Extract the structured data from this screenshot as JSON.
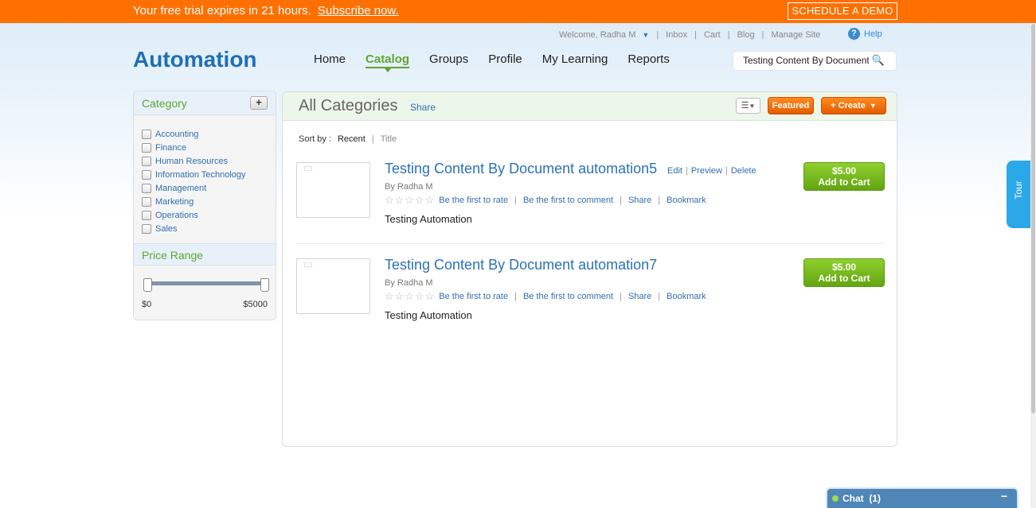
{
  "banner": {
    "trial_text": "Your free trial expires in 21 hours.",
    "subscribe_link": "Subscribe now.",
    "demo_button": "SCHEDULE A DEMO",
    "color": "#ff7000"
  },
  "utility_nav": {
    "welcome": "Welcome, Radha M",
    "inbox": "Inbox",
    "cart": "Cart",
    "blog": "Blog",
    "manage_site": "Manage Site",
    "help": "Help"
  },
  "logo": "Automation",
  "main_nav": {
    "home": "Home",
    "catalog": "Catalog",
    "groups": "Groups",
    "profile": "Profile",
    "my_learning": "My Learning",
    "reports": "Reports",
    "active": "Catalog"
  },
  "search": {
    "value": "Testing Content By Document",
    "icon": "search-icon"
  },
  "sidebar": {
    "category_title": "Category",
    "add_label": "+",
    "categories": [
      "Accounting",
      "Finance",
      "Human Resources",
      "Information Technology",
      "Management",
      "Marketing",
      "Operations",
      "Sales"
    ],
    "price_title": "Price Range",
    "price_min": "$0",
    "price_max": "$5000",
    "price_low_fraction": 0,
    "price_high_fraction": 1
  },
  "content": {
    "title": "All Categories",
    "share": "Share",
    "featured_button": "Featured",
    "create_button": "+ Create",
    "sort_label": "Sort by :",
    "sort_recent": "Recent",
    "sort_title": "Title",
    "items": [
      {
        "title": "Testing Content By Document automation5",
        "edit": "Edit",
        "preview": "Preview",
        "delete": "Delete",
        "author": "By Radha M",
        "rating": "☆☆☆☆☆",
        "rate_link": "Be the first to rate",
        "comment_link": "Be the first to comment",
        "share_link": "Share",
        "bookmark_link": "Bookmark",
        "description": "Testing Automation",
        "price": "$5.00",
        "cart_label": "Add to Cart"
      },
      {
        "title": "Testing Content By Document automation7",
        "author": "By Radha M",
        "rating": "☆☆☆☆☆",
        "rate_link": "Be the first to rate",
        "comment_link": "Be the first to comment",
        "share_link": "Share",
        "bookmark_link": "Bookmark",
        "description": "Testing Automation",
        "price": "$5.00",
        "cart_label": "Add to Cart"
      }
    ]
  },
  "tour": "Tour",
  "chat": {
    "label": "Chat",
    "count": "(1)",
    "minimize": "−"
  }
}
